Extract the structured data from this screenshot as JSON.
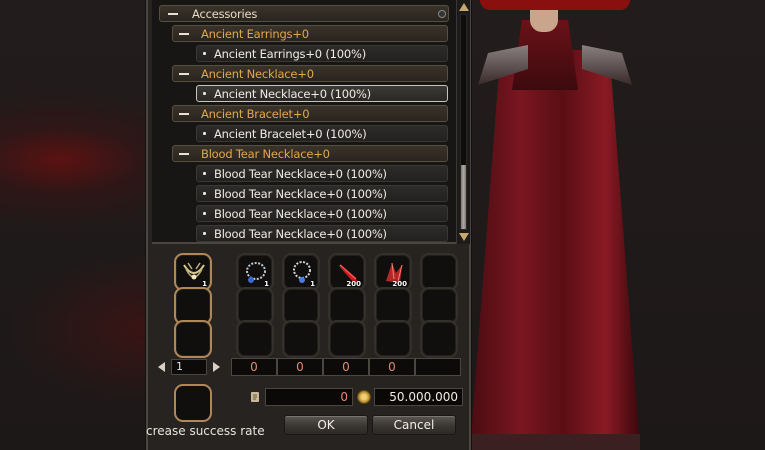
{
  "tree": {
    "category": {
      "label": "Accessories"
    },
    "groups": [
      {
        "label": "Ancient Earrings+0",
        "items": [
          "Ancient Earrings+0 (100%)"
        ]
      },
      {
        "label": "Ancient Necklace+0",
        "items": [
          "Ancient Necklace+0 (100%)"
        ]
      },
      {
        "label": "Ancient Bracelet+0",
        "items": [
          "Ancient Bracelet+0 (100%)"
        ]
      },
      {
        "label": "Blood Tear Necklace+0",
        "items": [
          "Blood Tear Necklace+0 (100%)",
          "Blood Tear Necklace+0 (100%)",
          "Blood Tear Necklace+0 (100%)",
          "Blood Tear Necklace+0 (100%)"
        ]
      }
    ],
    "selected_item": "Ancient Necklace+0 (100%)"
  },
  "slots": {
    "main_count": "1",
    "material_counts": [
      "1",
      "1",
      "200",
      "200"
    ],
    "material_icons": [
      "necklace-icon",
      "necklace-icon",
      "blood-tear-icon",
      "crystal-shard-icon"
    ]
  },
  "pager": {
    "page": "1"
  },
  "quantities": [
    "0",
    "0",
    "0",
    "0"
  ],
  "footer": {
    "left_value": "0",
    "gold_value": "50.000.000",
    "hint": "crease success rate",
    "ok_label": "OK",
    "cancel_label": "Cancel"
  }
}
